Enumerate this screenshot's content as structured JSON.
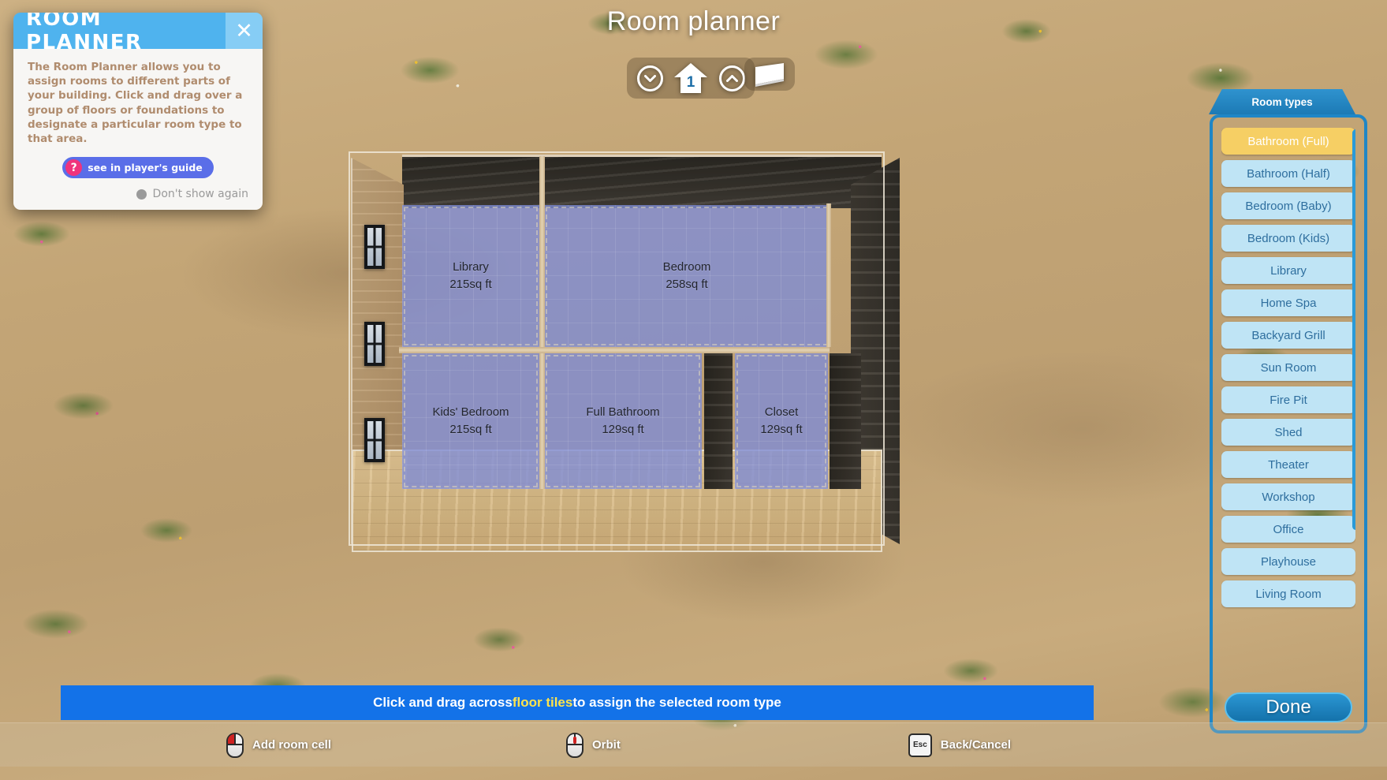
{
  "page_title": "Room planner",
  "help_popup": {
    "title": "ROOM PLANNER",
    "close_icon": "close-x-icon",
    "body_text": "The Room Planner allows you to assign rooms to different parts of your building. Click and drag over a group of floors or foundations to designate a particular room type to that area.",
    "guide_button": {
      "badge": "?",
      "label": "see in player's guide"
    },
    "dont_show_again": "Don't show again"
  },
  "floor_nav": {
    "down_icon": "chevron-down-circle-icon",
    "floor_number": "1",
    "house_icon": "house-icon",
    "up_icon": "chevron-up-circle-icon",
    "roof_icon": "roof-slab-icon"
  },
  "rooms": [
    {
      "name": "Library",
      "area": "215sq ft"
    },
    {
      "name": "Bedroom",
      "area": "258sq ft"
    },
    {
      "name": "Kids' Bedroom",
      "area": "215sq ft"
    },
    {
      "name": "Full Bathroom",
      "area": "129sq ft"
    },
    {
      "name": "Closet",
      "area": "129sq ft"
    }
  ],
  "sidebar": {
    "tab_label": "Room types",
    "selected": "Bathroom (Full)",
    "items": [
      {
        "label": "Bathroom (Full)",
        "selected": true
      },
      {
        "label": "Bathroom (Half)",
        "selected": false
      },
      {
        "label": "Bedroom (Baby)",
        "selected": false
      },
      {
        "label": "Bedroom (Kids)",
        "selected": false
      },
      {
        "label": "Library",
        "selected": false
      },
      {
        "label": "Home Spa",
        "selected": false
      },
      {
        "label": "Backyard Grill",
        "selected": false
      },
      {
        "label": "Sun Room",
        "selected": false
      },
      {
        "label": "Fire Pit",
        "selected": false
      },
      {
        "label": "Shed",
        "selected": false
      },
      {
        "label": "Theater",
        "selected": false
      },
      {
        "label": "Workshop",
        "selected": false
      },
      {
        "label": "Office",
        "selected": false
      },
      {
        "label": "Playhouse",
        "selected": false
      },
      {
        "label": "Living Room",
        "selected": false
      }
    ],
    "done_label": "Done"
  },
  "instruction": {
    "prefix": "Click and drag across ",
    "highlight": "floor tiles",
    "suffix": " to assign the selected room type"
  },
  "hints": [
    {
      "label": "Add room cell",
      "input": "left-mouse-button"
    },
    {
      "label": "Orbit",
      "input": "middle-mouse-button"
    },
    {
      "label": "Back/Cancel",
      "input": "Esc"
    }
  ],
  "colors": {
    "accent_blue": "#1372e8",
    "panel_border": "#1f86c6",
    "selected_item": "#f6cf64",
    "item_bg": "#bfe4f5",
    "room_fill": "#7e8cd7",
    "highlight_yellow": "#ffe44d"
  }
}
